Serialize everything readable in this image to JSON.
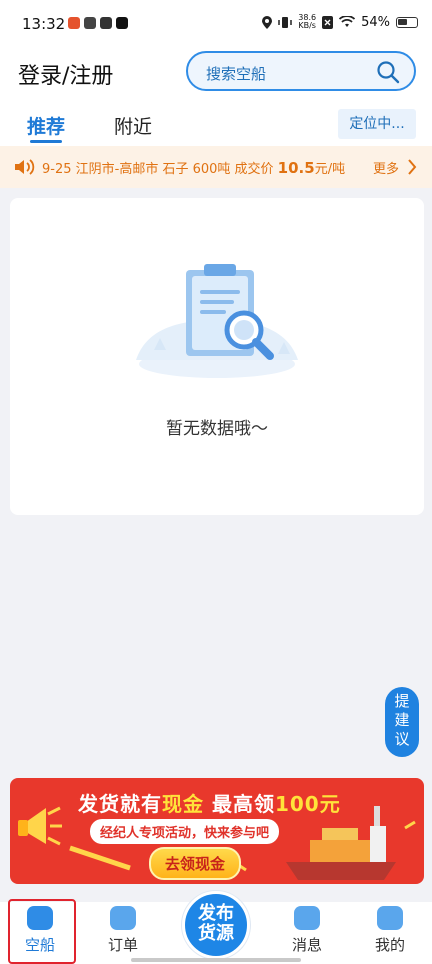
{
  "status_bar": {
    "time": "13:32",
    "net_speed_value": "38.6",
    "net_speed_unit": "KB/s",
    "battery": "54%"
  },
  "header": {
    "title": "登录/注册",
    "search_placeholder": "搜索空船"
  },
  "tabs": {
    "recommend": "推荐",
    "nearby": "附近",
    "locate": "定位中..."
  },
  "ticker": {
    "text": "9-25 江阴市-高邮市 石子 600吨  成交价 ",
    "price": "10.5",
    "unit": "元/吨",
    "more": "更多"
  },
  "empty_state": {
    "message": "暂无数据哦～"
  },
  "feedback": {
    "chars": [
      "提",
      "建",
      "议"
    ]
  },
  "banner": {
    "title_part1": "发货就有",
    "title_highlight1": "现金",
    "title_part2": " 最高领",
    "title_highlight2": "100元",
    "subtitle": "经纪人专项活动，快来参与吧",
    "button": "去领现金"
  },
  "bottom_nav": {
    "ship": "空船",
    "order": "订单",
    "publish_line1": "发布",
    "publish_line2": "货源",
    "message": "消息",
    "mine": "我的"
  },
  "colors": {
    "accent": "#1f7ad6",
    "ticker": "#e07212",
    "banner": "#e8382c",
    "highlight_box": "#e0242e"
  }
}
